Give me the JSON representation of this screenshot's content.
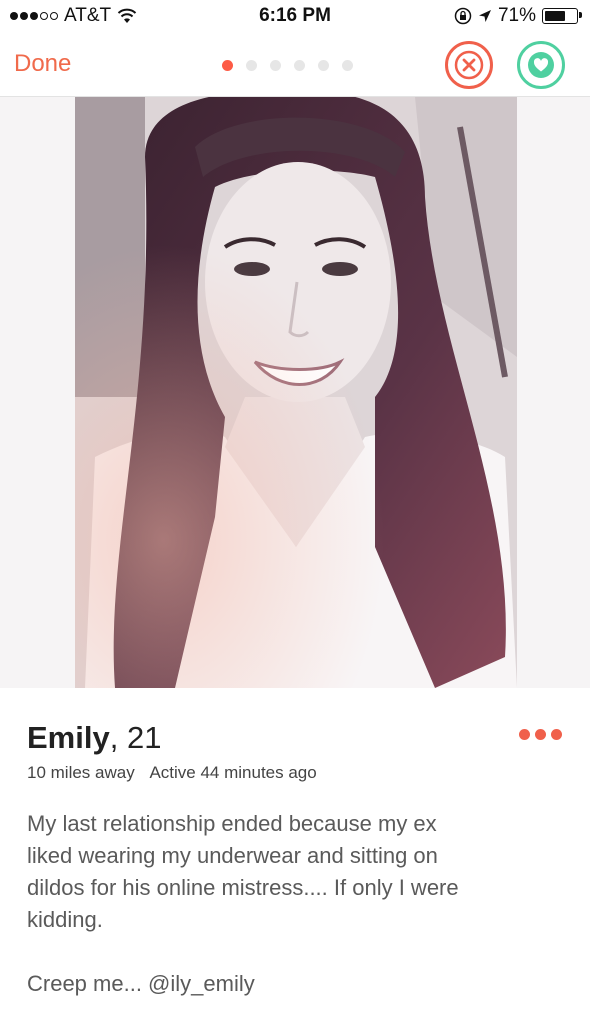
{
  "status_bar": {
    "carrier": "AT&T",
    "time": "6:16 PM",
    "battery_percent": "71%",
    "battery_level": 0.71
  },
  "nav": {
    "done_label": "Done",
    "photo_count": 6,
    "active_photo_index": 0,
    "nope_icon": "close-icon",
    "like_icon": "heart-icon",
    "accent_color": "#fd5b45",
    "like_color": "#4fd0a0"
  },
  "profile": {
    "name": "Emily",
    "age": "21",
    "distance": "10 miles away",
    "active": "Active 44 minutes ago",
    "bio_lines": [
      "My last relationship ended because my ex",
      "liked wearing my underwear and sitting on",
      "dildos for his online mistress.... If only I were",
      "kidding."
    ],
    "bio_extra": "Creep me... @ily_emily"
  }
}
